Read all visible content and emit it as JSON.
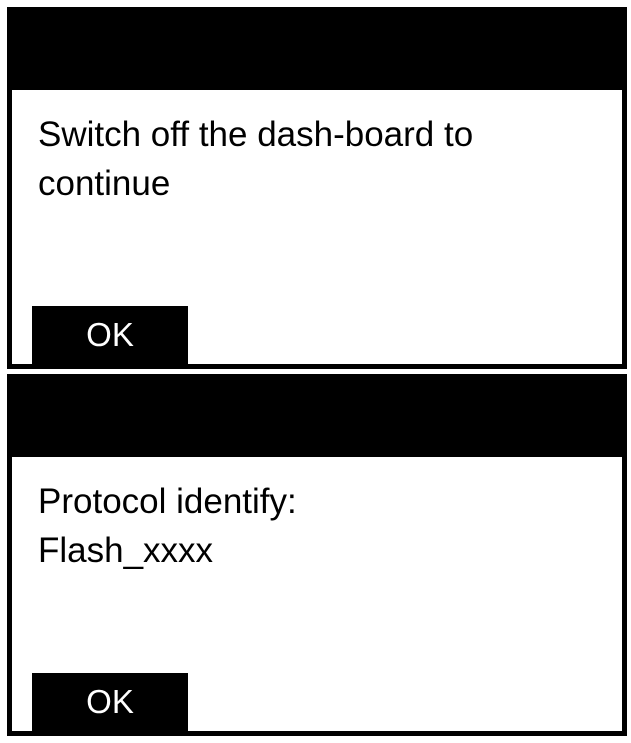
{
  "dialogs": [
    {
      "lines": [
        "Switch off the dash-board to",
        "continue"
      ],
      "ok_label": "OK"
    },
    {
      "lines": [
        "Protocol identify:",
        "Flash_xxxx"
      ],
      "ok_label": "OK"
    }
  ],
  "colors": {
    "bar": "#000000",
    "background": "#ffffff",
    "button_text": "#ffffff"
  }
}
